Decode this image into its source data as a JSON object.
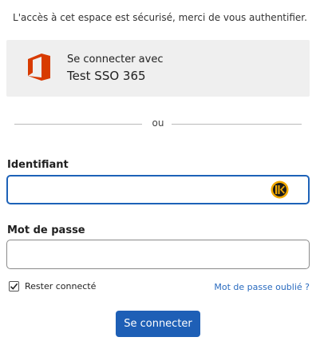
{
  "intro_text": "L'accès à cet espace est sécurisé, merci de vous authentifier.",
  "sso": {
    "line1": "Se connecter avec",
    "line2": "Test SSO 365",
    "icon": "office-logo-icon",
    "icon_color": "#d83b01"
  },
  "separator_text": "ou",
  "username": {
    "label": "Identifiant",
    "value": "",
    "password_manager_icon": "keeper-icon"
  },
  "password": {
    "label": "Mot de passe",
    "value": ""
  },
  "remember": {
    "label": "Rester connecté",
    "checked": true
  },
  "forgot_link": "Mot de passe oublié ?",
  "submit_label": "Se connecter",
  "colors": {
    "accent": "#1e5fb6",
    "link": "#2a6bbf",
    "focus_border": "#1d62b8"
  }
}
